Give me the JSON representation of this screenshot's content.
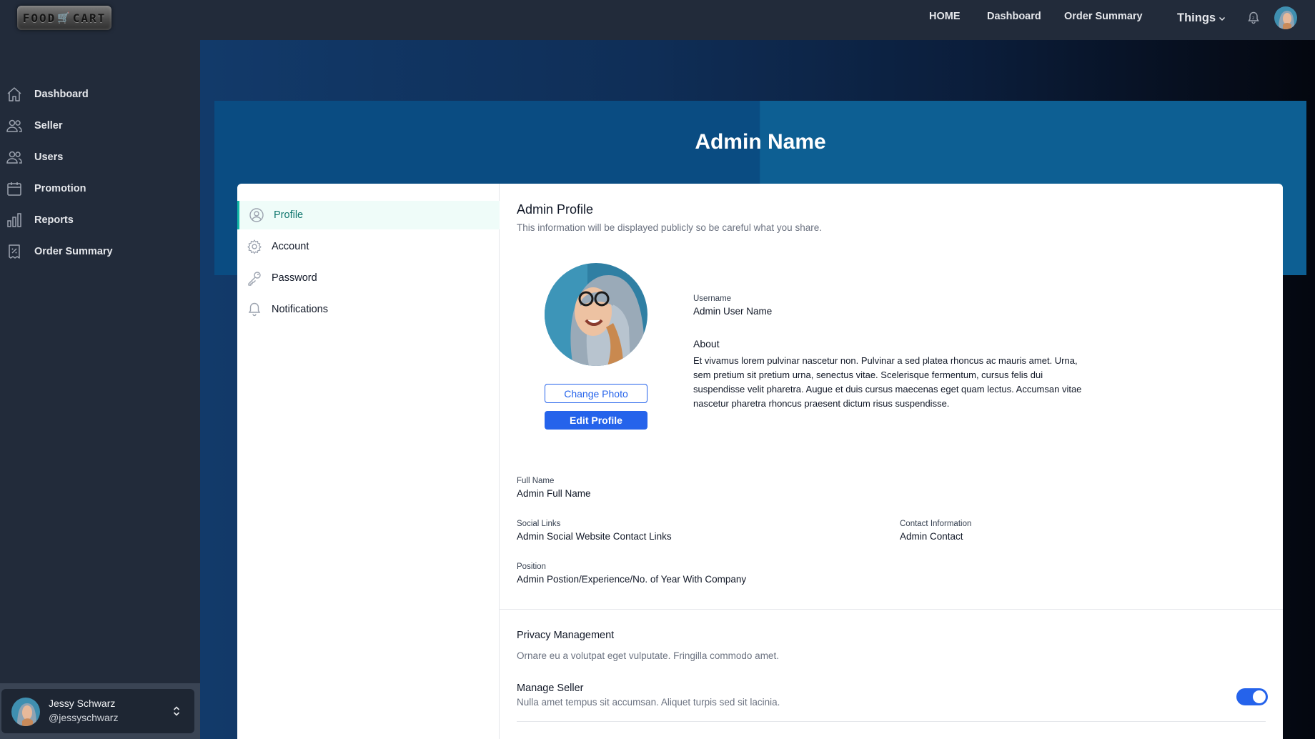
{
  "brand": {
    "logo_text_left": "FOOD",
    "logo_text_right": "CART"
  },
  "topnav": {
    "home": "HOME",
    "dashboard": "Dashboard",
    "order_summary": "Order Summary",
    "things": "Things"
  },
  "sidebar": {
    "items": [
      {
        "label": "Dashboard",
        "icon": "home-icon"
      },
      {
        "label": "Seller",
        "icon": "users-icon"
      },
      {
        "label": "Users",
        "icon": "users-icon"
      },
      {
        "label": "Promotion",
        "icon": "calendar-icon"
      },
      {
        "label": "Reports",
        "icon": "bar-chart-icon"
      },
      {
        "label": "Order Summary",
        "icon": "receipt-icon"
      }
    ],
    "user": {
      "name": "Jessy Schwarz",
      "handle": "@jessyschwarz"
    }
  },
  "banner": {
    "title": "Admin Name"
  },
  "subnav": {
    "items": [
      {
        "label": "Profile",
        "icon": "user-circle-icon",
        "active": true
      },
      {
        "label": "Account",
        "icon": "gear-icon",
        "active": false
      },
      {
        "label": "Password",
        "icon": "key-icon",
        "active": false
      },
      {
        "label": "Notifications",
        "icon": "bell-icon",
        "active": false
      }
    ]
  },
  "profile": {
    "title": "Admin Profile",
    "subtitle": "This information will be displayed publicly so be careful what you share.",
    "change_photo": "Change Photo",
    "edit_profile": "Edit Profile",
    "username_label": "Username",
    "username_value": "Admin User Name",
    "about_label": "About",
    "about_text": "Et vivamus lorem pulvinar nascetur non. Pulvinar a sed platea rhoncus ac mauris amet. Urna, sem pretium sit pretium urna, senectus vitae. Scelerisque fermentum, cursus felis dui suspendisse velit pharetra. Augue et duis cursus maecenas eget quam lectus. Accumsan vitae nascetur pharetra rhoncus praesent dictum risus suspendisse.",
    "full_name_label": "Full Name",
    "full_name_value": "Admin Full Name",
    "social_label": "Social Links",
    "social_value": "Admin Social Website Contact Links",
    "contact_label": "Contact Information",
    "contact_value": "Admin Contact",
    "position_label": "Position",
    "position_value": "Admin Postion/Experience/No. of Year With Company"
  },
  "privacy": {
    "title": "Privacy Management",
    "subtitle": "Ornare eu a volutpat eget vulputate. Fringilla commodo amet.",
    "manage_seller_title": "Manage Seller",
    "manage_seller_sub": "Nulla amet tempus sit accumsan. Aliquet turpis sed sit lacinia.",
    "manage_seller_enabled": true
  },
  "colors": {
    "accent": "#2563eb",
    "active_nav": "#14b8a6",
    "sidebar_bg": "#222b3a",
    "banner_bg": "#0a4c82"
  }
}
